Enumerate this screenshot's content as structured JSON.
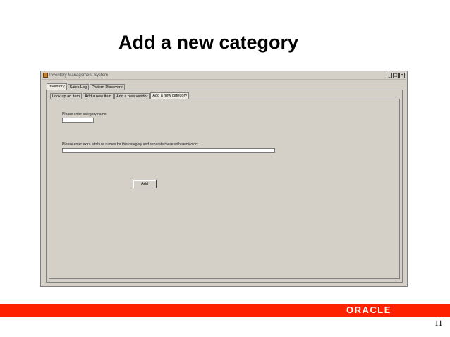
{
  "slide": {
    "title": "Add a new category",
    "page_number": "11",
    "logo_text": "ORACLE"
  },
  "window": {
    "title": "Inventory Management System",
    "controls": {
      "minimize": "_",
      "maximize": "□",
      "close": "×"
    }
  },
  "outer_tabs": [
    {
      "label": "Inventory",
      "active": true
    },
    {
      "label": "Sales Log",
      "active": false
    },
    {
      "label": "Pattern Discovere",
      "active": false
    }
  ],
  "inner_tabs": [
    {
      "label": "Look up an item",
      "active": false
    },
    {
      "label": "Add a new item",
      "active": false
    },
    {
      "label": "Add a new vendor",
      "active": false
    },
    {
      "label": "Add a new category",
      "active": true
    }
  ],
  "form": {
    "category_name_label": "Please enter category name:",
    "category_name_value": "",
    "attributes_label": "Please enter extra attribute names for this category and separate these with semicolon:",
    "attributes_value": "",
    "add_button_label": "Add"
  },
  "colors": {
    "accent_red": "#ff2200",
    "window_bg": "#d4d0c8"
  }
}
